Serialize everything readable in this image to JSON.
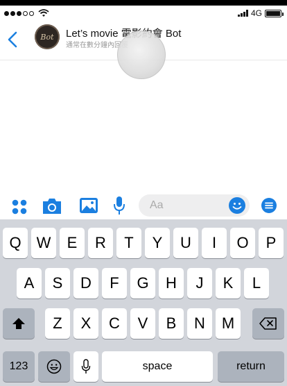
{
  "status_bar": {
    "network": "4G"
  },
  "chat_header": {
    "title": "Let’s movie 電影約會 Bot",
    "subtitle": "通常在數分鐘內回覆",
    "avatar_text": "Bot"
  },
  "composer": {
    "placeholder": "Aa",
    "accent_color": "#1b7fe0",
    "icons": [
      "apps-icon",
      "camera-icon",
      "gallery-icon",
      "microphone-icon",
      "emoji-icon",
      "menu-icon"
    ]
  },
  "keyboard": {
    "row1": [
      "Q",
      "W",
      "E",
      "R",
      "T",
      "Y",
      "U",
      "I",
      "O",
      "P"
    ],
    "row2": [
      "A",
      "S",
      "D",
      "F",
      "G",
      "H",
      "J",
      "K",
      "L"
    ],
    "row3": [
      "Z",
      "X",
      "C",
      "V",
      "B",
      "N",
      "M"
    ],
    "numbers_label": "123",
    "space_label": "space",
    "return_label": "return"
  }
}
